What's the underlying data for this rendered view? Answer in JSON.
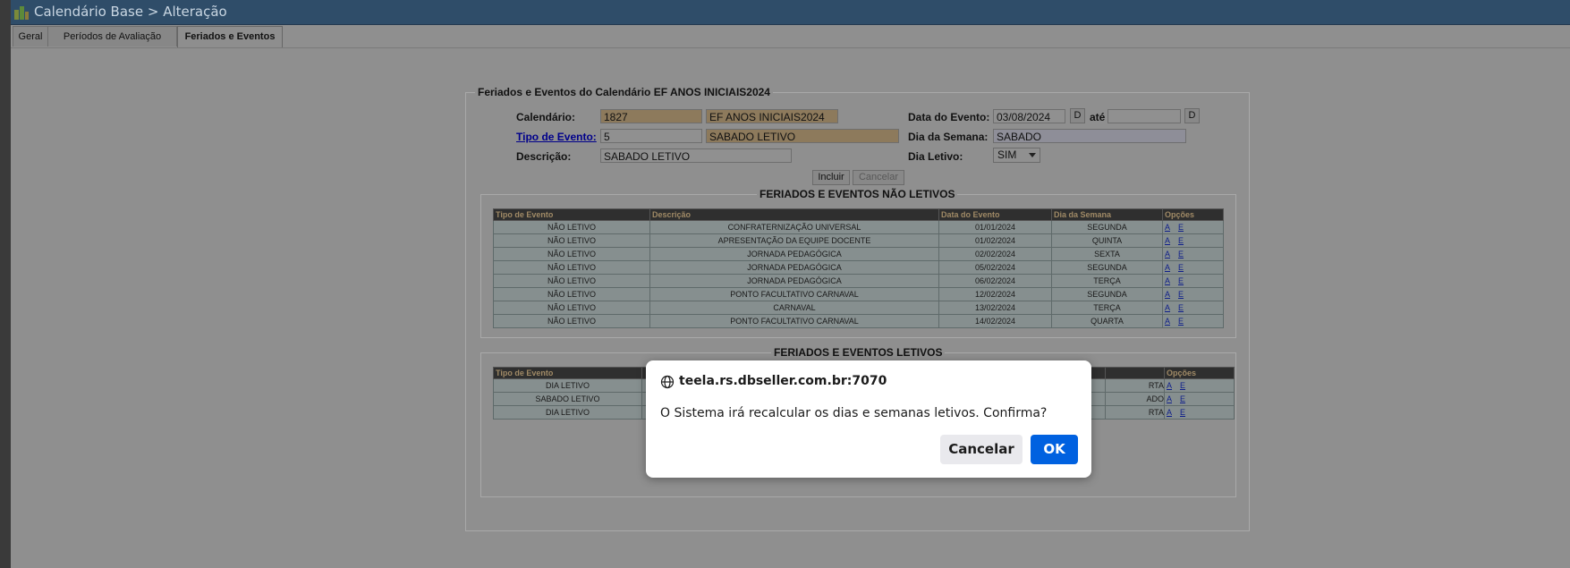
{
  "window": {
    "title": "Calendário Base > Alteração"
  },
  "tabs": [
    {
      "label": "Geral"
    },
    {
      "label": "Períodos de Avaliação"
    },
    {
      "label": "Feriados e Eventos"
    }
  ],
  "form": {
    "legend": "Feriados e Eventos do Calendário EF ANOS INICIAIS2024",
    "calendario_label": "Calendário:",
    "calendario_code": "1827",
    "calendario_name": "EF ANOS INICIAIS2024",
    "tipo_label": "Tipo de Evento:",
    "tipo_code": "5",
    "tipo_name": "SABADO LETIVO",
    "descricao_label": "Descrição:",
    "descricao_value": "SABADO LETIVO",
    "data_label": "Data do Evento:",
    "data_value": "03/08/2024",
    "d_button": "D",
    "ate_label": "até",
    "ate_value": "",
    "d2_button": "D",
    "dia_semana_label": "Dia da Semana:",
    "dia_semana_value": "SABADO",
    "dia_letivo_label": "Dia Letivo:",
    "dia_letivo_value": "SIM",
    "incluir_button": "Incluir",
    "cancelar_button": "Cancelar"
  },
  "nao_letivos": {
    "legend": "FERIADOS E EVENTOS NÃO LETIVOS",
    "headers": [
      "Tipo de Evento",
      "Descrição",
      "Data do Evento",
      "Dia da Semana",
      "Opções"
    ],
    "rows": [
      [
        "NÃO LETIVO",
        "CONFRATERNIZAÇÃO UNIVERSAL",
        "01/01/2024",
        "SEGUNDA"
      ],
      [
        "NÃO LETIVO",
        "APRESENTAÇÃO DA EQUIPE DOCENTE",
        "01/02/2024",
        "QUINTA"
      ],
      [
        "NÃO LETIVO",
        "JORNADA PEDAGÓGICA",
        "02/02/2024",
        "SEXTA"
      ],
      [
        "NÃO LETIVO",
        "JORNADA PEDAGÓGICA",
        "05/02/2024",
        "SEGUNDA"
      ],
      [
        "NÃO LETIVO",
        "JORNADA PEDAGÓGICA",
        "06/02/2024",
        "TERÇA"
      ],
      [
        "NÃO LETIVO",
        "PONTO FACULTATIVO CARNAVAL",
        "12/02/2024",
        "SEGUNDA"
      ],
      [
        "NÃO LETIVO",
        "CARNAVAL",
        "13/02/2024",
        "TERÇA"
      ],
      [
        "NÃO LETIVO",
        "PONTO FACULTATIVO CARNAVAL",
        "14/02/2024",
        "QUARTA"
      ]
    ],
    "opt_a": "A",
    "opt_e": "E"
  },
  "letivos": {
    "legend": "FERIADOS E EVENTOS LETIVOS",
    "headers": [
      "Tipo de Evento",
      "Opções"
    ],
    "rows": [
      [
        "DIA LETIVO",
        "RTA"
      ],
      [
        "SABADO LETIVO",
        "ADO"
      ],
      [
        "DIA LETIVO",
        "RTA"
      ]
    ],
    "opt_a": "A",
    "opt_e": "E"
  },
  "dialog": {
    "host": "teela.rs.dbseller.com.br:7070",
    "message": "O Sistema irá recalcular os dias e semanas letivos. Confirma?",
    "cancel_label": "Cancelar",
    "ok_label": "OK"
  },
  "colors": {
    "ok_button": "#0061e0",
    "title_bar": "#2f4d69"
  }
}
